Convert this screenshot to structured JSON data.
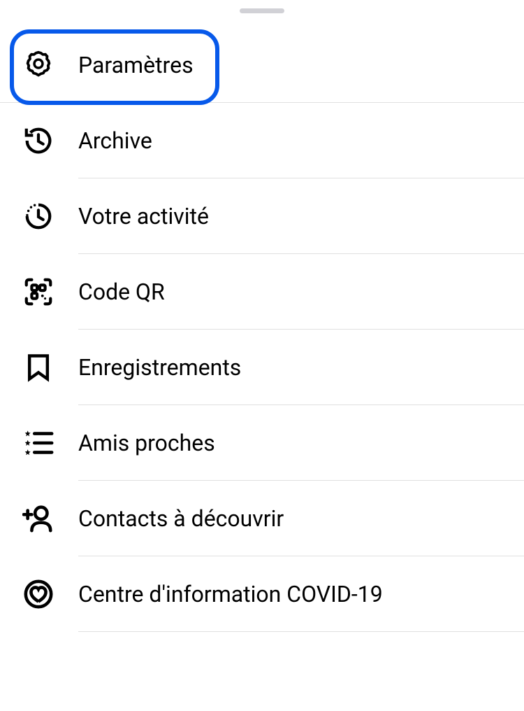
{
  "menu": {
    "items": [
      {
        "label": "Paramètres",
        "icon": "gear-icon"
      },
      {
        "label": "Archive",
        "icon": "archive-icon"
      },
      {
        "label": "Votre activité",
        "icon": "activity-icon"
      },
      {
        "label": "Code QR",
        "icon": "qr-icon"
      },
      {
        "label": "Enregistrements",
        "icon": "bookmark-icon"
      },
      {
        "label": "Amis proches",
        "icon": "close-friends-icon"
      },
      {
        "label": "Contacts à découvrir",
        "icon": "discover-people-icon"
      },
      {
        "label": "Centre d'information COVID-19",
        "icon": "covid-info-icon"
      }
    ]
  },
  "highlighted_index": 0
}
